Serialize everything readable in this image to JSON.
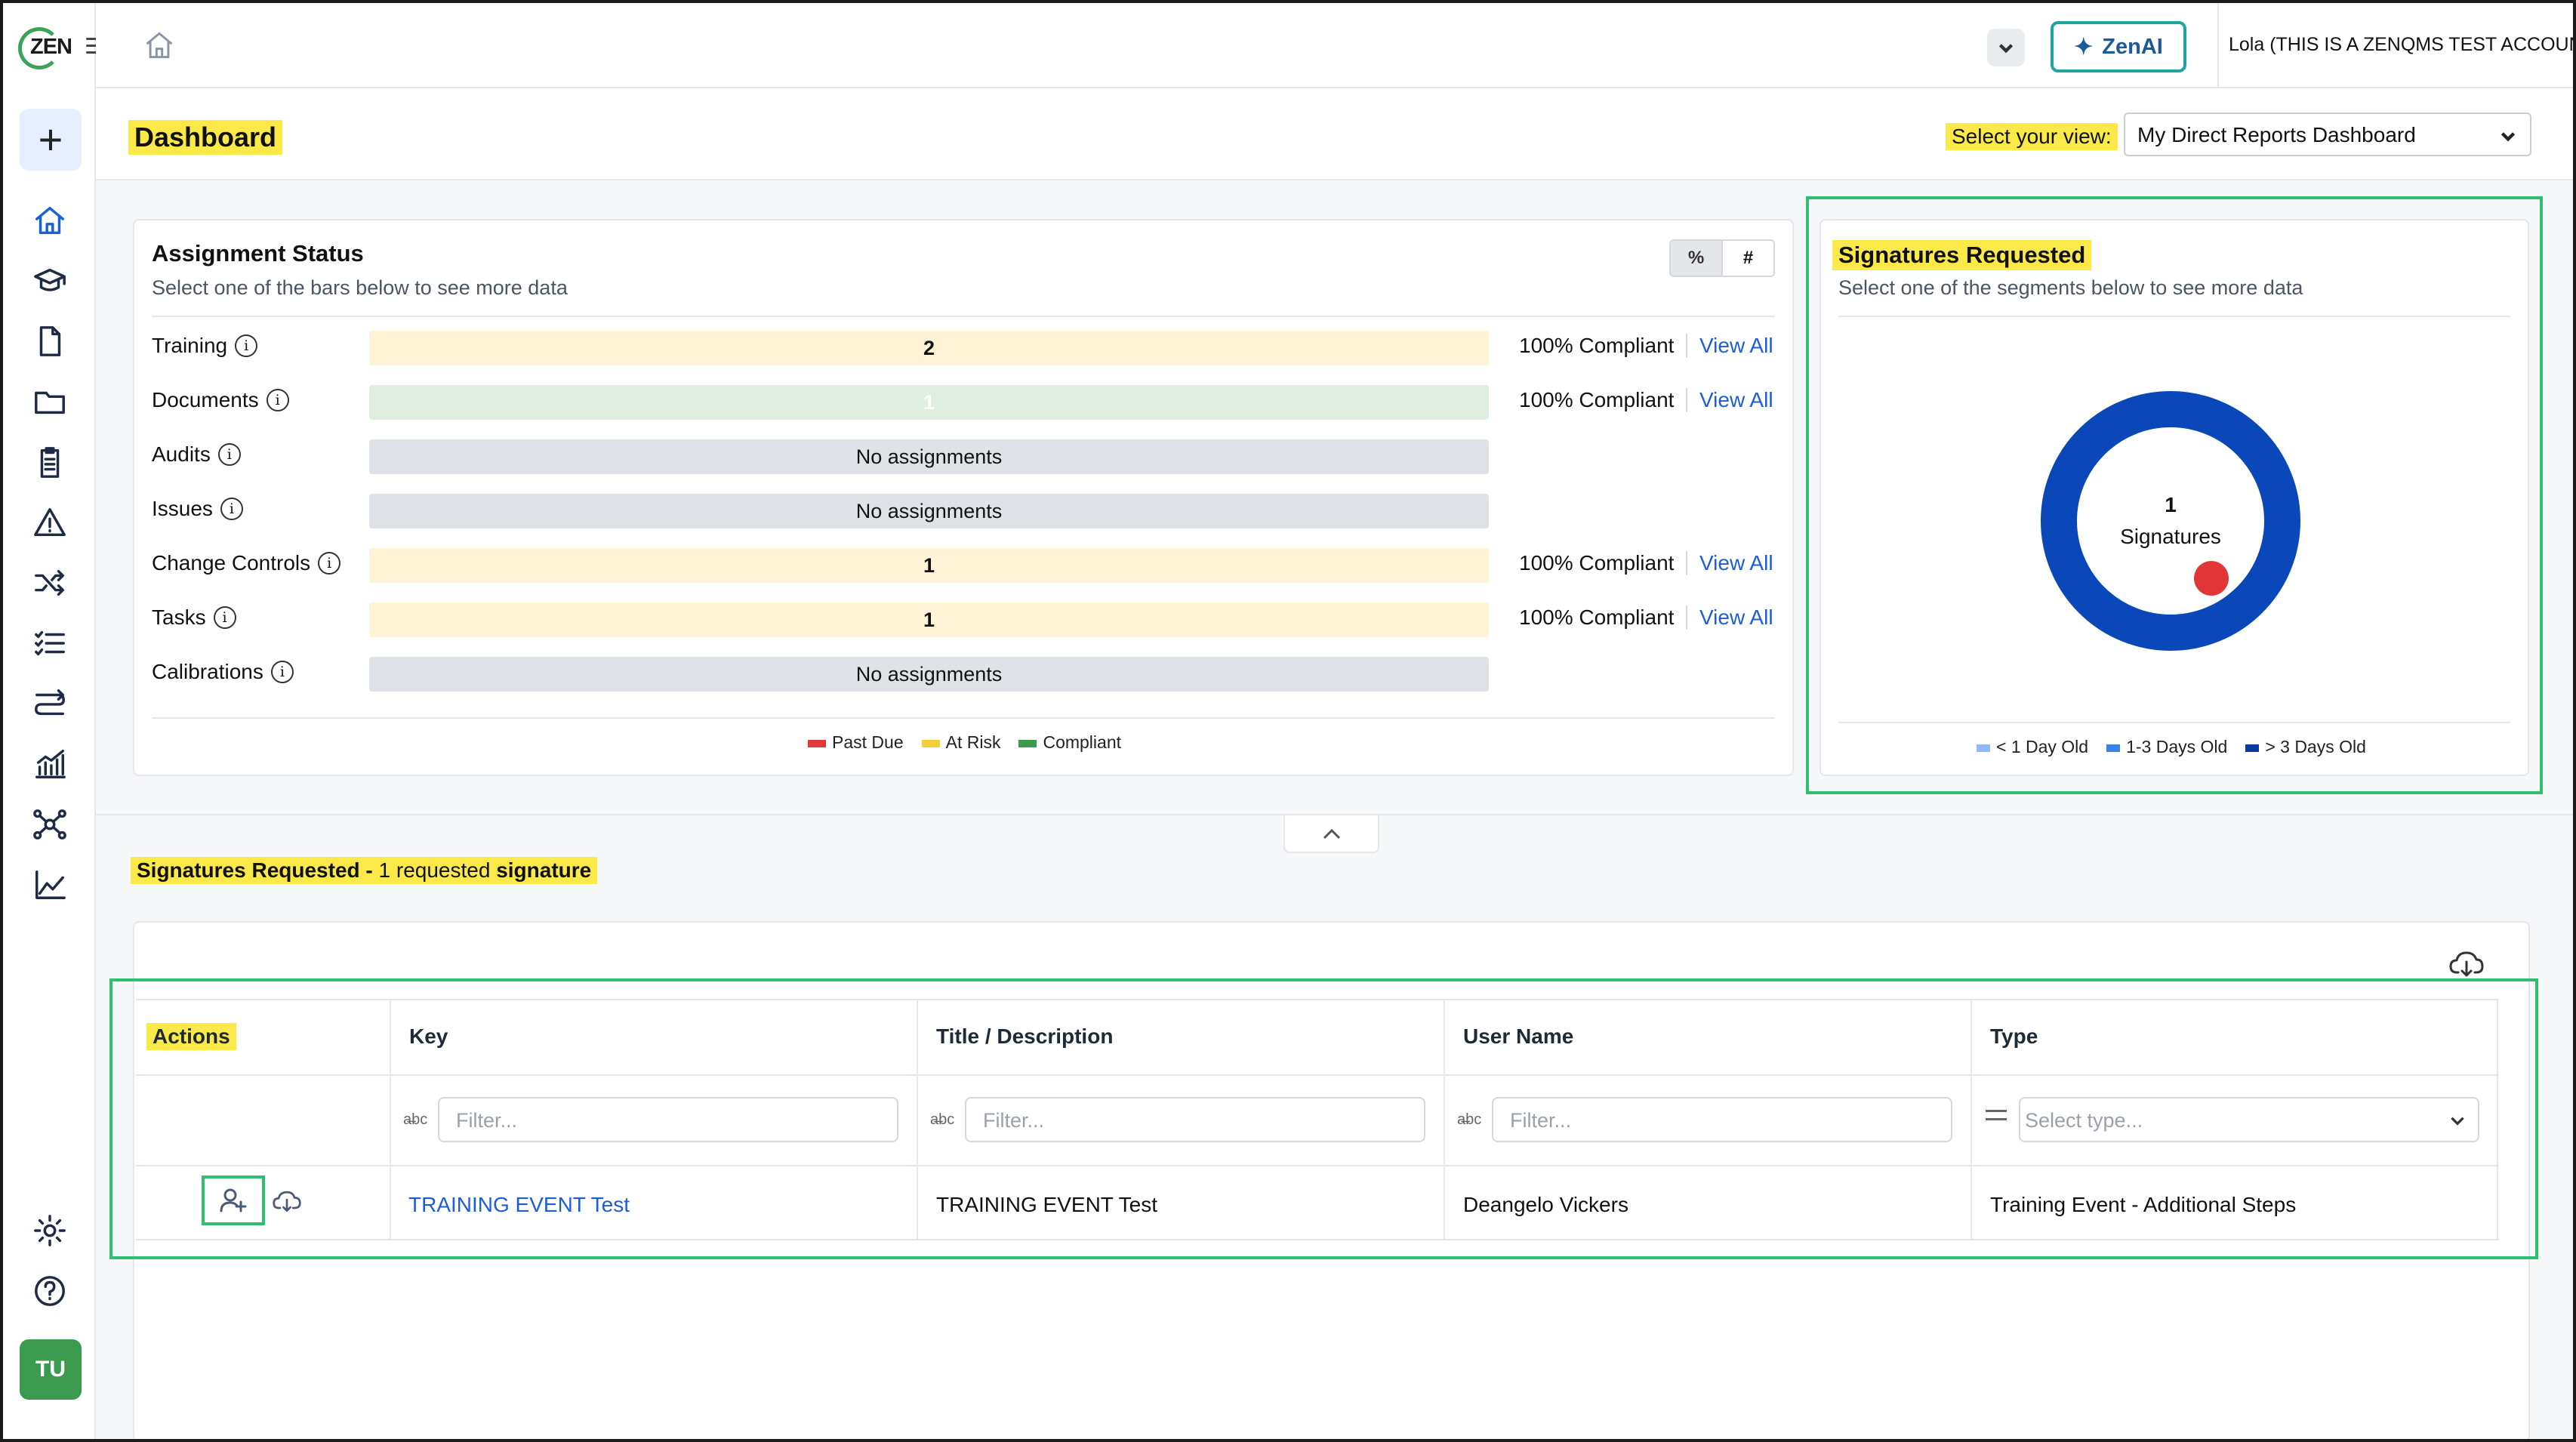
{
  "app": {
    "logo": "ZEN",
    "user": "Lola (THIS IS A ZENQMS TEST ACCOUNT)",
    "zenai_label": "ZenAI",
    "avatar_initials": "TU"
  },
  "header": {
    "title": "Dashboard",
    "view_label": "Select your view:",
    "view_selected": "My Direct Reports Dashboard"
  },
  "assignment_status": {
    "title": "Assignment Status",
    "subtitle": "Select one of the bars below to see more data",
    "toggle": [
      "%",
      "#"
    ],
    "rows": [
      {
        "label": "Training",
        "bar_text": "2",
        "status": "risk",
        "compliance": "100% Compliant",
        "link": "View All"
      },
      {
        "label": "Documents",
        "bar_text": "1",
        "status": "comp",
        "compliance": "100% Compliant",
        "link": "View All"
      },
      {
        "label": "Audits",
        "bar_text": "No assignments",
        "status": "none",
        "compliance": "",
        "link": ""
      },
      {
        "label": "Issues",
        "bar_text": "No assignments",
        "status": "none",
        "compliance": "",
        "link": ""
      },
      {
        "label": "Change Controls",
        "bar_text": "1",
        "status": "risk",
        "compliance": "100% Compliant",
        "link": "View All"
      },
      {
        "label": "Tasks",
        "bar_text": "1",
        "status": "risk",
        "compliance": "100% Compliant",
        "link": "View All"
      },
      {
        "label": "Calibrations",
        "bar_text": "No assignments",
        "status": "none",
        "compliance": "",
        "link": ""
      }
    ],
    "legend": [
      {
        "label": "Past Due",
        "color": "#e03a3a"
      },
      {
        "label": "At Risk",
        "color": "#f5cf3a"
      },
      {
        "label": "Compliant",
        "color": "#3a9a4e"
      }
    ]
  },
  "signatures_card": {
    "title": "Signatures Requested",
    "subtitle": "Select one of the segments below to see more data",
    "center_value": "1",
    "center_label": "Signatures",
    "ring_color": "#0a47b8",
    "legend": [
      {
        "label": "< 1 Day Old",
        "color": "#8fb8f5"
      },
      {
        "label": "1-3 Days Old",
        "color": "#3b82e6"
      },
      {
        "label": "> 3 Days Old",
        "color": "#0a3aa0"
      }
    ]
  },
  "signatures_section": {
    "title_bold": "Signatures Requested -",
    "count_text": "1 requested",
    "suffix_bold": "signature"
  },
  "table": {
    "columns": [
      "Actions",
      "Key",
      "Title / Description",
      "User Name",
      "Type"
    ],
    "filter_placeholder": "Filter...",
    "type_placeholder": "Select type...",
    "rows": [
      {
        "key": "TRAINING EVENT Test",
        "title": "TRAINING EVENT Test",
        "user": "Deangelo Vickers",
        "type": "Training Event - Additional Steps"
      }
    ]
  }
}
